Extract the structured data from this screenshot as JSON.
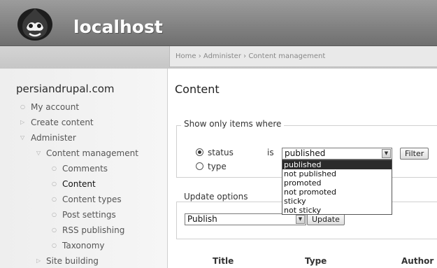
{
  "header": {
    "site_name": "localhost",
    "logo_icon": "drupal-drop-logo-icon"
  },
  "breadcrumb": {
    "items": [
      "Home",
      "Administer",
      "Content management"
    ],
    "separator": "›"
  },
  "sidebar": {
    "title": "persiandrupal.com",
    "items": [
      {
        "label": "My account",
        "bullet": "○"
      },
      {
        "label": "Create content",
        "bullet": "▷"
      },
      {
        "label": "Administer",
        "bullet": "▽"
      },
      {
        "label": "Content management",
        "bullet": "▽"
      },
      {
        "label": "Comments",
        "bullet": "○"
      },
      {
        "label": "Content",
        "bullet": "○"
      },
      {
        "label": "Content types",
        "bullet": "○"
      },
      {
        "label": "Post settings",
        "bullet": "○"
      },
      {
        "label": "RSS publishing",
        "bullet": "○"
      },
      {
        "label": "Taxonomy",
        "bullet": "○"
      },
      {
        "label": "Site building",
        "bullet": "▷"
      }
    ]
  },
  "main": {
    "title": "Content",
    "filter": {
      "legend": "Show only items where",
      "status_label": "status",
      "type_label": "type",
      "is_label": "is",
      "selected_value": "published",
      "filter_button": "Filter",
      "options": [
        "published",
        "not published",
        "promoted",
        "not promoted",
        "sticky",
        "not sticky"
      ]
    },
    "update": {
      "legend": "Update options",
      "selected_value": "Publish",
      "update_button": "Update"
    },
    "table_headers": [
      "Title",
      "Type",
      "Author"
    ]
  }
}
